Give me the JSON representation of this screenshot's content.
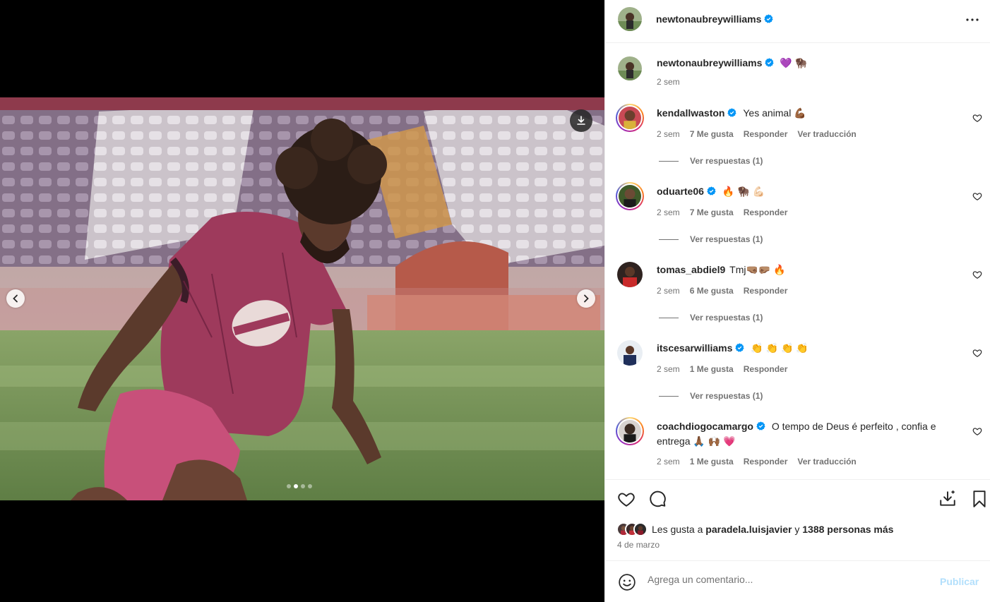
{
  "post": {
    "author": "newtonaubreywilliams",
    "more_icon": "more-horizontal-icon",
    "caption_emojis": "💜 🦬",
    "caption_time": "2 sem"
  },
  "media": {
    "slide_count": 4,
    "active_slide": 2,
    "prev_icon": "chevron-left-icon",
    "next_icon": "chevron-right-icon",
    "download_icon": "download-icon"
  },
  "comments": [
    {
      "user": "kendallwaston",
      "verified": true,
      "text": "Yes animal 💪🏾",
      "time": "2 sem",
      "likes": "7 Me gusta",
      "reply": "Responder",
      "translate": "Ver traducción",
      "view_replies": "Ver respuestas (1)"
    },
    {
      "user": "oduarte06",
      "verified": true,
      "text": "🔥 🦬 💪🏻",
      "time": "2 sem",
      "likes": "7 Me gusta",
      "reply": "Responder",
      "view_replies": "Ver respuestas (1)"
    },
    {
      "user": "tomas_abdiel9",
      "verified": false,
      "text": "Tmj🤜🏽🤛🏽 🔥",
      "time": "2 sem",
      "likes": "6 Me gusta",
      "reply": "Responder",
      "view_replies": "Ver respuestas (1)"
    },
    {
      "user": "itscesarwilliams",
      "verified": true,
      "text": "👏 👏 👏 👏",
      "time": "2 sem",
      "likes": "1 Me gusta",
      "reply": "Responder",
      "view_replies": "Ver respuestas (1)"
    },
    {
      "user": "coachdiogocamargo",
      "verified": true,
      "text": "O tempo de Deus é perfeito , confia e entrega 🙏🏾 🙌🏾 💗",
      "time": "2 sem",
      "likes": "1 Me gusta",
      "reply": "Responder",
      "translate": "Ver traducción"
    }
  ],
  "actions": {
    "like_icon": "heart-icon",
    "comment_icon": "comment-icon",
    "save_to_icon": "save-to-collection-icon",
    "bookmark_icon": "bookmark-icon"
  },
  "likes": {
    "prefix": "Les gusta a",
    "user": "paradela.luisjavier",
    "connector": "y",
    "others": "1388 personas más"
  },
  "date": "4 de marzo",
  "comment_box": {
    "placeholder": "Agrega un comentario...",
    "publish": "Publicar",
    "emoji_icon": "emoji-smiley-icon"
  },
  "colors": {
    "verified": "#0095f6",
    "publish_disabled": "#b2dffc",
    "secondary_text": "#737373"
  }
}
